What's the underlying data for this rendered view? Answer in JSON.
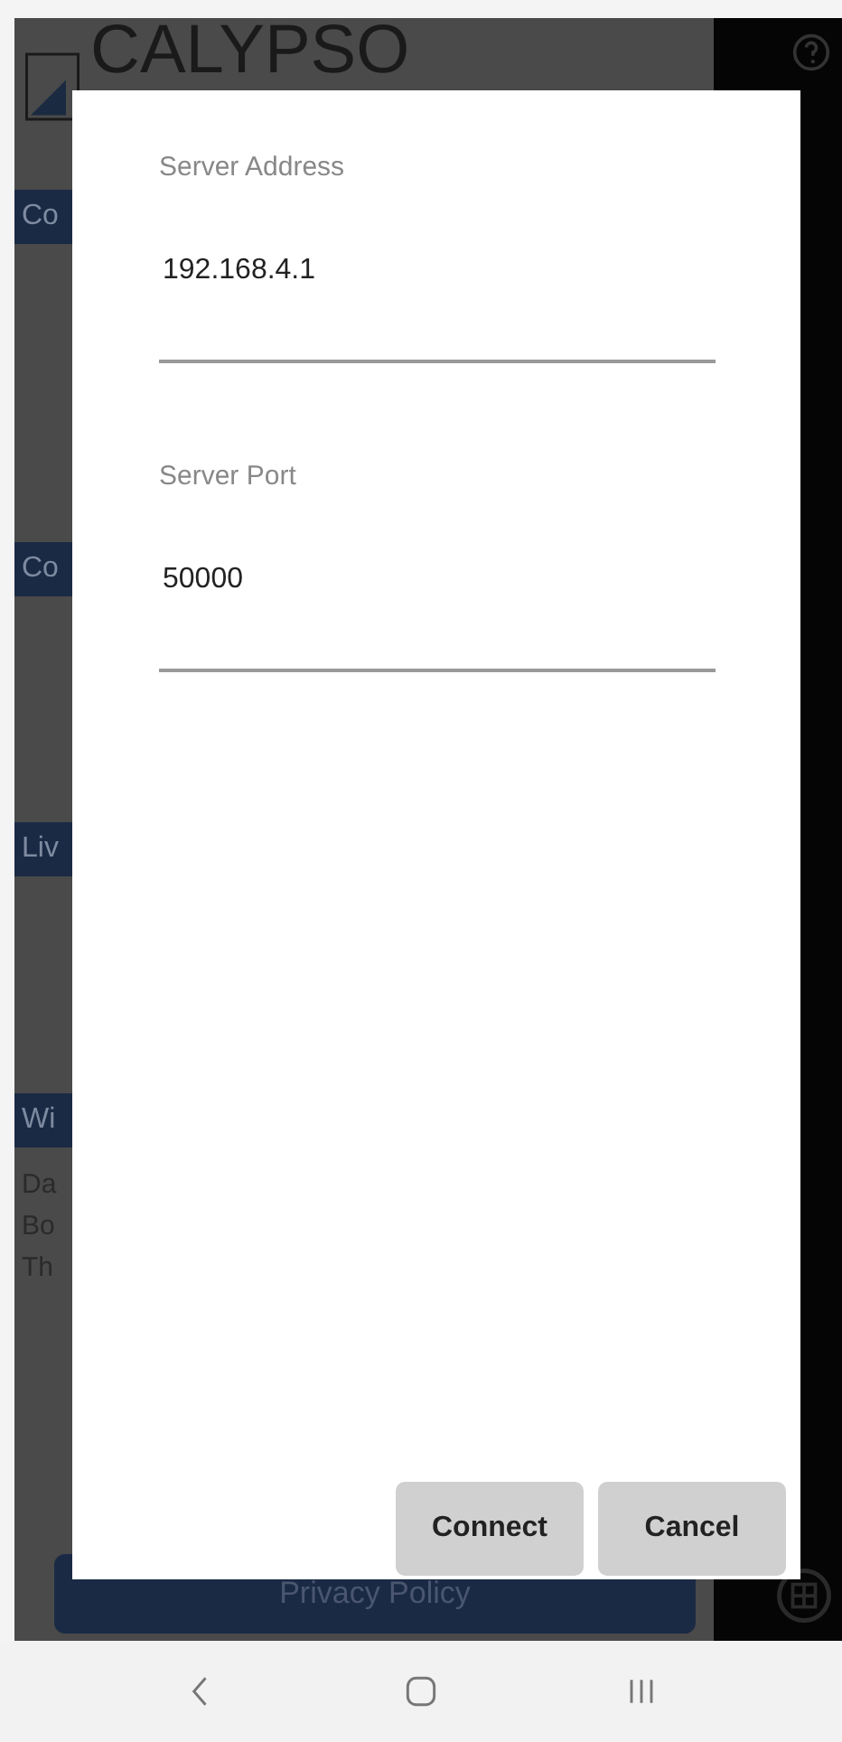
{
  "app": {
    "logo_text": "CALYPSO",
    "sections": [
      {
        "title": "Co"
      },
      {
        "title": "Co"
      },
      {
        "title": "Liv"
      },
      {
        "title": "Wi",
        "rows": [
          "Da",
          "Bo",
          "Th"
        ]
      }
    ],
    "privacy_button": "Privacy Policy"
  },
  "dialog": {
    "fields": [
      {
        "label": "Server Address",
        "value": "192.168.4.1"
      },
      {
        "label": "Server Port",
        "value": "50000"
      }
    ],
    "buttons": [
      "Connect",
      "Cancel"
    ]
  }
}
